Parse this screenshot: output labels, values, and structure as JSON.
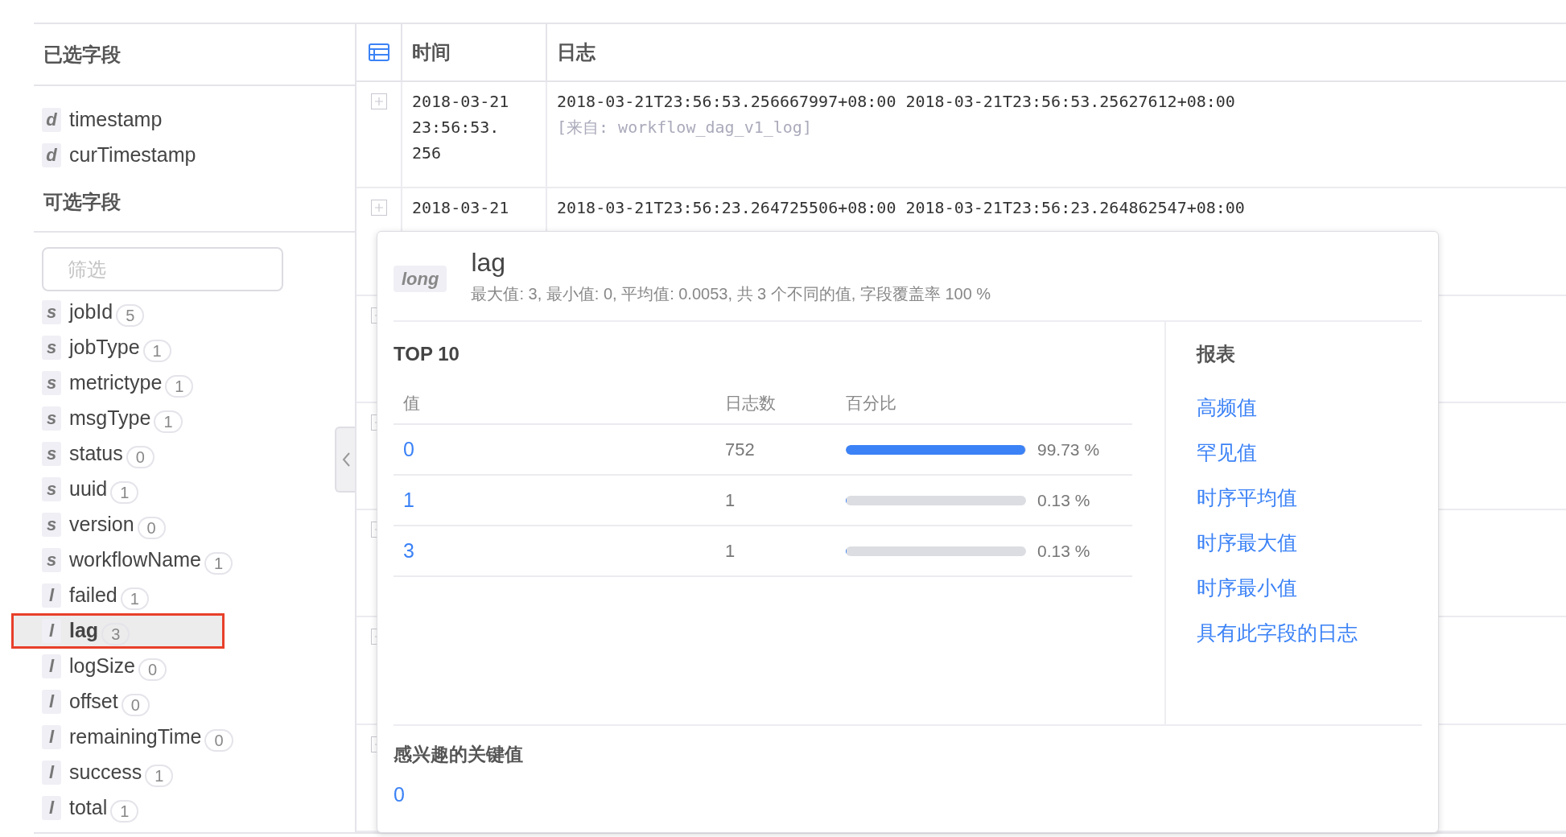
{
  "sidebar": {
    "selected_heading": "已选字段",
    "selected_fields": [
      {
        "type": "d",
        "name": "timestamp"
      },
      {
        "type": "d",
        "name": "curTimestamp"
      }
    ],
    "available_heading": "可选字段",
    "filter": {
      "placeholder": "筛选"
    },
    "available_fields": [
      {
        "type": "s",
        "name": "jobId",
        "count": "5",
        "selected": false,
        "annotated": false
      },
      {
        "type": "s",
        "name": "jobType",
        "count": "1",
        "selected": false,
        "annotated": false
      },
      {
        "type": "s",
        "name": "metrictype",
        "count": "1",
        "selected": false,
        "annotated": false
      },
      {
        "type": "s",
        "name": "msgType",
        "count": "1",
        "selected": false,
        "annotated": false
      },
      {
        "type": "s",
        "name": "status",
        "count": "0",
        "selected": false,
        "annotated": false
      },
      {
        "type": "s",
        "name": "uuid",
        "count": "1",
        "selected": false,
        "annotated": false
      },
      {
        "type": "s",
        "name": "version",
        "count": "0",
        "selected": false,
        "annotated": false
      },
      {
        "type": "s",
        "name": "workflowName",
        "count": "1",
        "selected": false,
        "annotated": false
      },
      {
        "type": "l",
        "name": "failed",
        "count": "1",
        "selected": false,
        "annotated": false
      },
      {
        "type": "l",
        "name": "lag",
        "count": "3",
        "selected": true,
        "annotated": true
      },
      {
        "type": "l",
        "name": "logSize",
        "count": "0",
        "selected": false,
        "annotated": false
      },
      {
        "type": "l",
        "name": "offset",
        "count": "0",
        "selected": false,
        "annotated": false
      },
      {
        "type": "l",
        "name": "remainingTime",
        "count": "0",
        "selected": false,
        "annotated": false
      },
      {
        "type": "l",
        "name": "success",
        "count": "1",
        "selected": false,
        "annotated": false
      },
      {
        "type": "l",
        "name": "total",
        "count": "1",
        "selected": false,
        "annotated": false
      }
    ]
  },
  "table": {
    "columns": [
      "时间",
      "日志"
    ],
    "rows": [
      {
        "time": "2018-03-21 23:56:53. 256",
        "log": "2018-03-21T23:56:53.256667997+08:00 2018-03-21T23:56:53.25627612+08:00",
        "source": "[来自: workflow_dag_v1_log]"
      },
      {
        "time": "2018-03-21",
        "log": "2018-03-21T23:56:23.264725506+08:00 2018-03-21T23:56:23.264862547+08:00"
      }
    ]
  },
  "popup": {
    "type_badge": "long",
    "title": "lag",
    "stats": "最大值: 3, 最小值: 0, 平均值: 0.0053, 共 3 个不同的值, 字段覆盖率 100 %",
    "top_heading": "TOP 10",
    "top_columns": [
      "值",
      "日志数",
      "百分比"
    ],
    "top_rows": [
      {
        "value": "0",
        "count": "752",
        "level": 0.9973,
        "percent": "99.73 %"
      },
      {
        "value": "1",
        "count": "1",
        "level": 0.0013,
        "percent": "0.13 %"
      },
      {
        "value": "3",
        "count": "1",
        "level": 0.0013,
        "percent": "0.13 %"
      }
    ],
    "reports_heading": "报表",
    "reports": [
      "高频值",
      "罕见值",
      "时序平均值",
      "时序最大值",
      "时序最小值",
      "具有此字段的日志"
    ],
    "key_values_heading": "感兴趣的关键值",
    "key_values": [
      "0"
    ]
  }
}
